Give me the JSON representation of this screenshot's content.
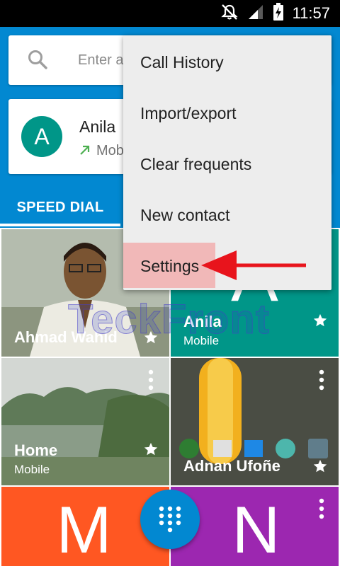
{
  "status_bar": {
    "time": "11:57",
    "icons": [
      "notifications-off-icon",
      "signal-icon",
      "battery-charging-icon"
    ]
  },
  "search": {
    "placeholder": "Enter a"
  },
  "contact": {
    "avatar_letter": "A",
    "name": "Anila",
    "call_type_icon": "outgoing-call-icon",
    "subtitle": "Mob"
  },
  "tabs": {
    "speed_dial": "SPEED DIAL"
  },
  "menu": {
    "items": [
      {
        "label": "Call History"
      },
      {
        "label": "Import/export"
      },
      {
        "label": "Clear frequents"
      },
      {
        "label": "New contact"
      },
      {
        "label": "Settings"
      }
    ]
  },
  "tiles": [
    {
      "name": "Ahmad Wahid",
      "sub": "",
      "starred": true
    },
    {
      "name": "Anila",
      "sub": "Mobile",
      "letter": "A",
      "color": "#009688",
      "starred": true
    },
    {
      "name": "Home",
      "sub": "Mobile",
      "starred": true
    },
    {
      "name": "Adnan Ufoñe",
      "sub": "",
      "starred": true
    },
    {
      "name": "",
      "letter": "M",
      "color": "#ff5722"
    },
    {
      "name": "",
      "letter": "N",
      "color": "#9c27b0"
    }
  ],
  "watermark": "TeckFront",
  "colors": {
    "primary": "#0288d1",
    "teal": "#009688",
    "orange": "#ff5722",
    "purple": "#9c27b0",
    "arrow": "#e8141c"
  }
}
